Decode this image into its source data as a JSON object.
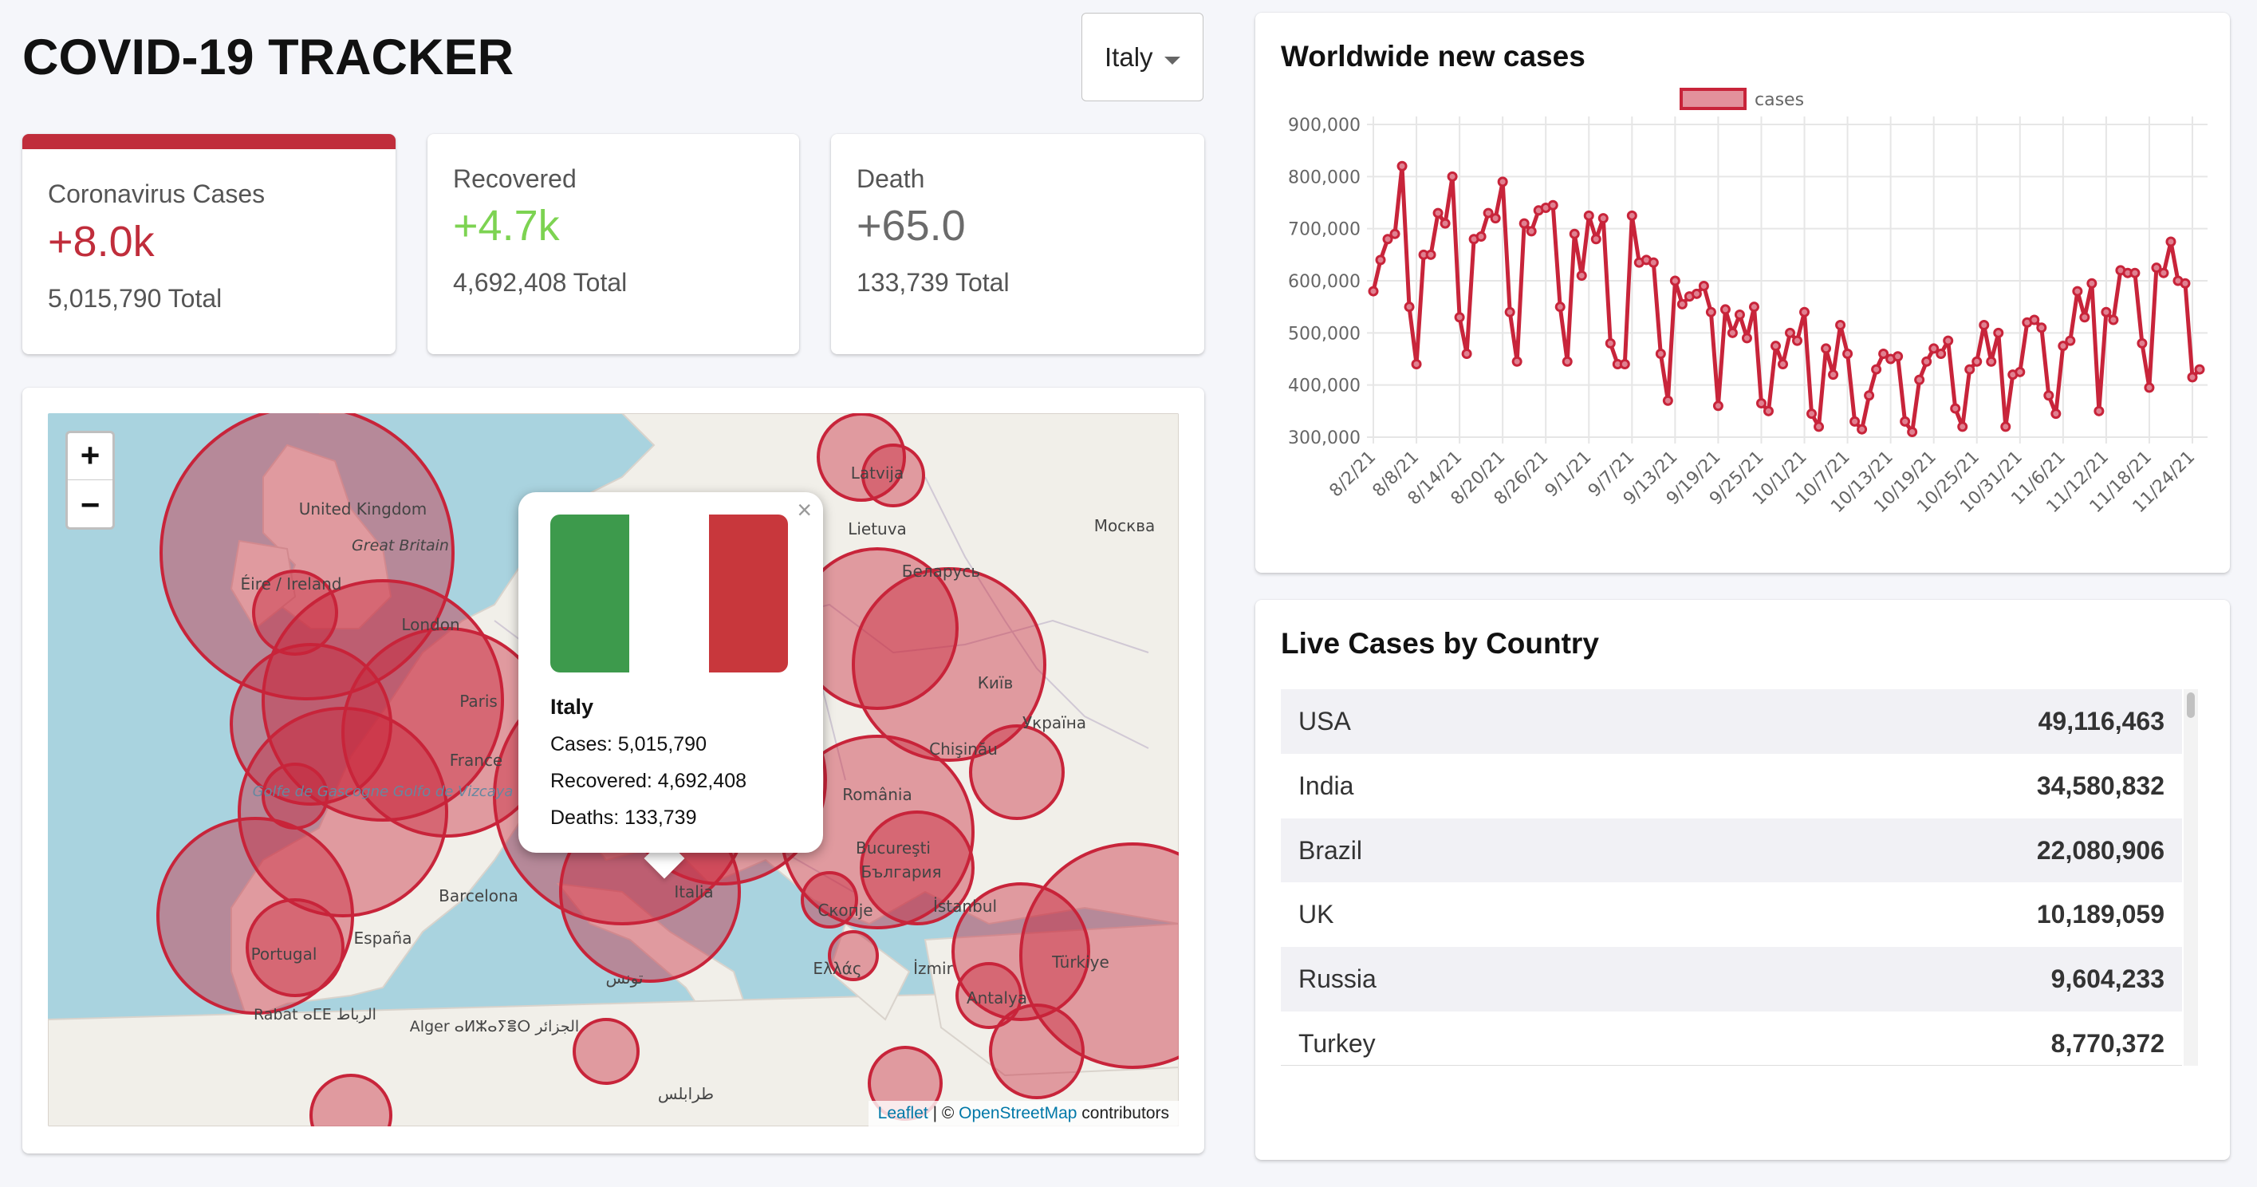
{
  "app": {
    "title": "COVID-19 TRACKER"
  },
  "country_select": {
    "value": "Italy"
  },
  "stats": {
    "cases": {
      "label": "Coronavirus Cases",
      "today": "+8.0k",
      "total": "5,015,790 Total",
      "color": "#c02d3b"
    },
    "recovered": {
      "label": "Recovered",
      "today": "+4.7k",
      "total": "4,692,408 Total",
      "color": "#7dd352"
    },
    "deaths": {
      "label": "Death",
      "today": "+65.0",
      "total": "133,739 Total",
      "color": "#6b6b6b"
    }
  },
  "map": {
    "zoom_in": "+",
    "zoom_out": "−",
    "popup": {
      "close": "×",
      "country": "Italy",
      "cases": "Cases: 5,015,790",
      "recovered": "Recovered: 4,692,408",
      "deaths": "Deaths: 133,739",
      "flag_colors": [
        "#3d9a4c",
        "#ffffff",
        "#c8373c"
      ]
    },
    "labels": [
      "United Kingdom",
      "Great Britain",
      "Éire / Ireland",
      "London",
      "Paris",
      "France",
      "Golfe de Gascogne Golfo de Vizcaya",
      "Barcelona",
      "España",
      "Portugal",
      "Rabat ⴰⵎⴹ الرباط",
      "Alger ⴰⵍⵣⴰⵢⴻⵔ الجزائر",
      "تونس",
      "طرابلس",
      "Italia",
      "Latvija",
      "Lietuva",
      "Беларусь",
      "Київ",
      "Україна",
      "Москва",
      "Chişinău",
      "România",
      "Bucureşti",
      "България",
      "Скопје",
      "Ελλάς",
      "İstanbul",
      "İzmir",
      "Türkiye",
      "Antalya"
    ],
    "attribution": {
      "leaflet": "Leaflet",
      "sep": " | © ",
      "osm": "OpenStreetMap",
      "suffix": " contributors"
    }
  },
  "chart_card": {
    "title": "Worldwide new cases"
  },
  "chart_data": {
    "type": "line",
    "title": "Worldwide new cases",
    "legend": "cases",
    "legend_position": "top",
    "color": "#c8243a",
    "ylim": [
      300000,
      900000
    ],
    "yticks": [
      "300,000",
      "400,000",
      "500,000",
      "600,000",
      "700,000",
      "800,000",
      "900,000"
    ],
    "xticks": [
      "8/2/21",
      "8/8/21",
      "8/14/21",
      "8/20/21",
      "8/26/21",
      "9/1/21",
      "9/7/21",
      "9/13/21",
      "9/19/21",
      "9/25/21",
      "10/1/21",
      "10/7/21",
      "10/13/21",
      "10/19/21",
      "10/25/21",
      "10/31/21",
      "11/6/21",
      "11/12/21",
      "11/18/21",
      "11/24/21"
    ],
    "grid": true,
    "series": [
      {
        "name": "cases",
        "values": [
          580000,
          640000,
          680000,
          690000,
          820000,
          550000,
          440000,
          650000,
          650000,
          730000,
          710000,
          800000,
          530000,
          460000,
          680000,
          685000,
          730000,
          720000,
          790000,
          540000,
          445000,
          710000,
          695000,
          735000,
          740000,
          745000,
          550000,
          445000,
          690000,
          610000,
          725000,
          680000,
          720000,
          480000,
          440000,
          440000,
          725000,
          635000,
          640000,
          635000,
          460000,
          370000,
          600000,
          555000,
          570000,
          575000,
          590000,
          540000,
          360000,
          545000,
          500000,
          535000,
          490000,
          550000,
          365000,
          350000,
          475000,
          440000,
          500000,
          485000,
          540000,
          345000,
          320000,
          470000,
          420000,
          515000,
          460000,
          330000,
          315000,
          380000,
          430000,
          460000,
          450000,
          455000,
          330000,
          310000,
          410000,
          445000,
          470000,
          460000,
          485000,
          355000,
          320000,
          430000,
          445000,
          515000,
          445000,
          500000,
          320000,
          420000,
          425000,
          520000,
          525000,
          510000,
          380000,
          345000,
          475000,
          485000,
          580000,
          530000,
          595000,
          350000,
          540000,
          525000,
          620000,
          615000,
          615000,
          480000,
          395000,
          625000,
          615000,
          675000,
          600000,
          595000,
          415000,
          430000
        ]
      }
    ]
  },
  "table": {
    "title": "Live Cases by Country",
    "rows": [
      {
        "country": "USA",
        "cases": "49,116,463"
      },
      {
        "country": "India",
        "cases": "34,580,832"
      },
      {
        "country": "Brazil",
        "cases": "22,080,906"
      },
      {
        "country": "UK",
        "cases": "10,189,059"
      },
      {
        "country": "Russia",
        "cases": "9,604,233"
      },
      {
        "country": "Turkey",
        "cases": "8,770,372"
      }
    ]
  }
}
